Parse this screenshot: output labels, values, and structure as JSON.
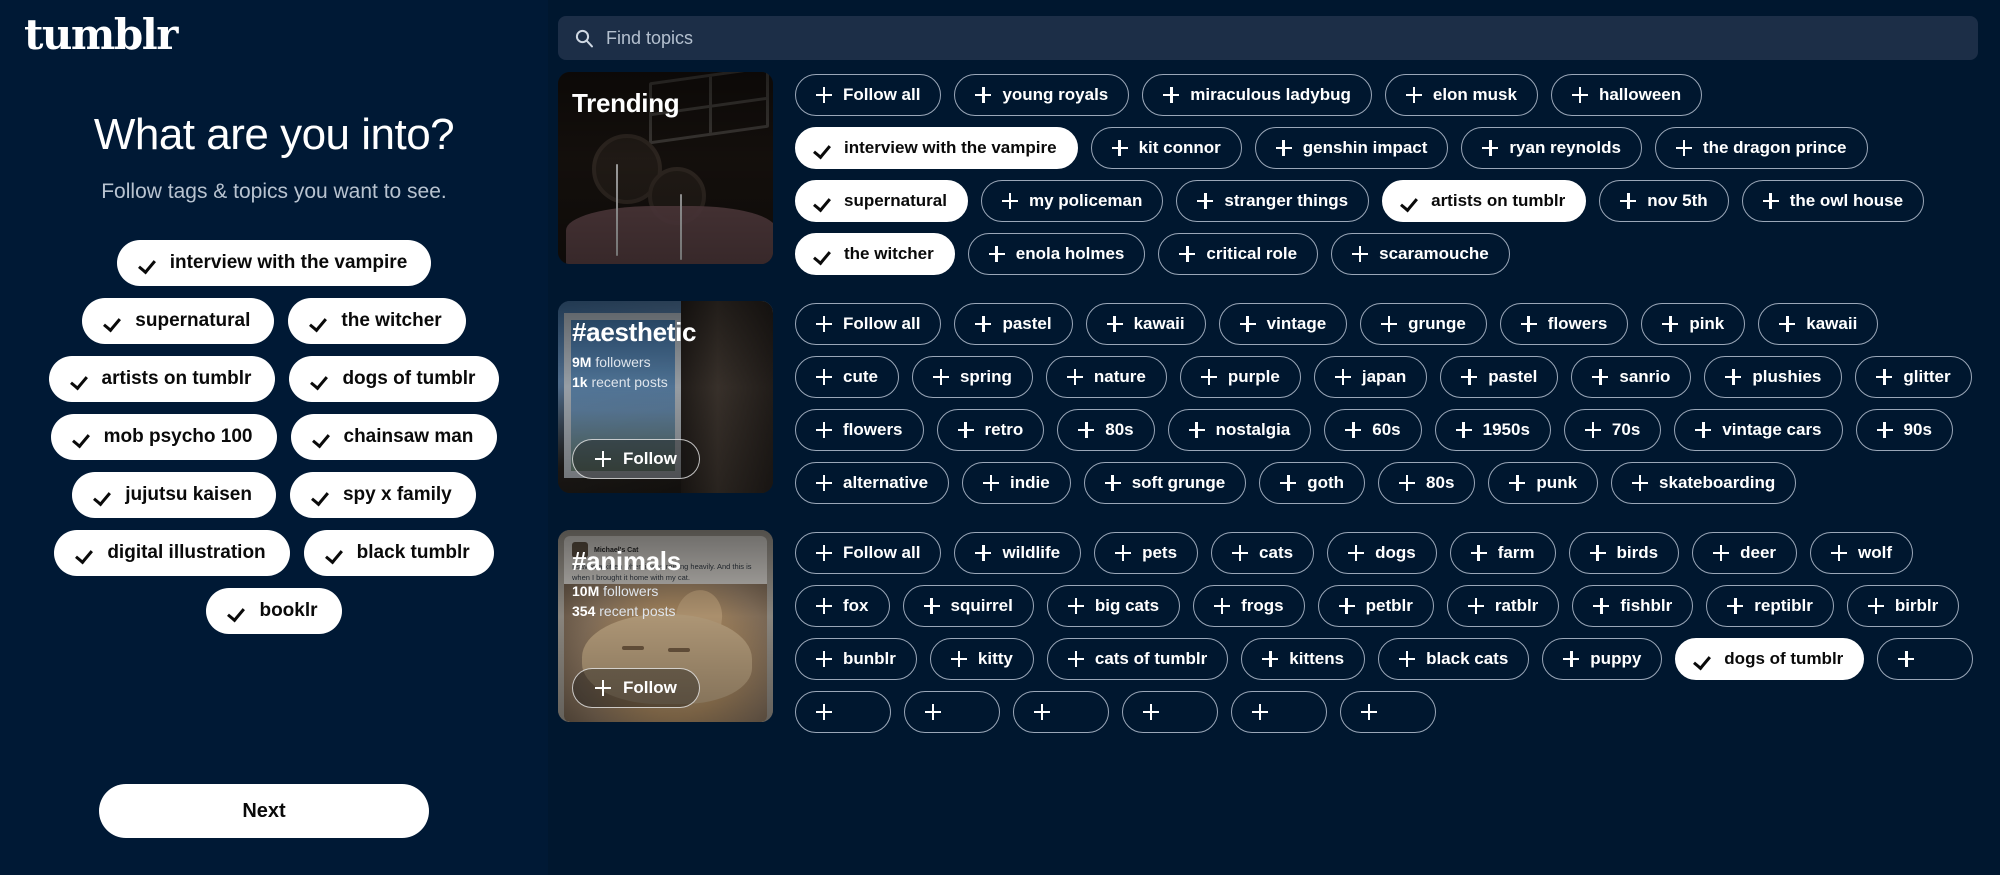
{
  "brand": {
    "logo_text": "tumblr",
    "background_color": "#001935",
    "accent_color": "#ffffff"
  },
  "left_panel": {
    "heading": "What are you into?",
    "subheading": "Follow tags & topics you want to see.",
    "next_label": "Next",
    "selected_tags": [
      "interview with the vampire",
      "supernatural",
      "the witcher",
      "artists on tumblr",
      "dogs of tumblr",
      "mob psycho 100",
      "chainsaw man",
      "jujutsu kaisen",
      "spy x family",
      "digital illustration",
      "black tumblr",
      "booklr"
    ]
  },
  "search": {
    "placeholder": "Find topics",
    "value": "",
    "icon": "search-icon"
  },
  "sections": [
    {
      "card": {
        "title": "Trending",
        "followers": "",
        "recent_posts": "",
        "follow_label": "",
        "has_follow_button": false,
        "art": "trending"
      },
      "tags": [
        {
          "label": "Follow all",
          "selected": false
        },
        {
          "label": "young royals",
          "selected": false
        },
        {
          "label": "miraculous ladybug",
          "selected": false
        },
        {
          "label": "elon musk",
          "selected": false
        },
        {
          "label": "halloween",
          "selected": false
        },
        {
          "label": "interview with the vampire",
          "selected": true
        },
        {
          "label": "kit connor",
          "selected": false
        },
        {
          "label": "genshin impact",
          "selected": false
        },
        {
          "label": "ryan reynolds",
          "selected": false
        },
        {
          "label": "the dragon prince",
          "selected": false
        },
        {
          "label": "supernatural",
          "selected": true
        },
        {
          "label": "my policeman",
          "selected": false
        },
        {
          "label": "stranger things",
          "selected": false
        },
        {
          "label": "artists on tumblr",
          "selected": true
        },
        {
          "label": "nov 5th",
          "selected": false
        },
        {
          "label": "the owl house",
          "selected": false
        },
        {
          "label": "the witcher",
          "selected": true
        },
        {
          "label": "enola holmes",
          "selected": false
        },
        {
          "label": "critical role",
          "selected": false
        },
        {
          "label": "scaramouche",
          "selected": false
        }
      ]
    },
    {
      "card": {
        "title": "#aesthetic",
        "followers_value": "9M",
        "followers_label": "followers",
        "recent_value": "1k",
        "recent_label": "recent posts",
        "follow_label": "Follow",
        "has_follow_button": true,
        "art": "aesthetic"
      },
      "tags": [
        {
          "label": "Follow all",
          "selected": false
        },
        {
          "label": "pastel",
          "selected": false
        },
        {
          "label": "kawaii",
          "selected": false
        },
        {
          "label": "vintage",
          "selected": false
        },
        {
          "label": "grunge",
          "selected": false
        },
        {
          "label": "flowers",
          "selected": false
        },
        {
          "label": "pink",
          "selected": false
        },
        {
          "label": "kawaii",
          "selected": false
        },
        {
          "label": "cute",
          "selected": false
        },
        {
          "label": "spring",
          "selected": false
        },
        {
          "label": "nature",
          "selected": false
        },
        {
          "label": "purple",
          "selected": false
        },
        {
          "label": "japan",
          "selected": false
        },
        {
          "label": "pastel",
          "selected": false
        },
        {
          "label": "sanrio",
          "selected": false
        },
        {
          "label": "plushies",
          "selected": false
        },
        {
          "label": "glitter",
          "selected": false
        },
        {
          "label": "flowers",
          "selected": false
        },
        {
          "label": "retro",
          "selected": false
        },
        {
          "label": "80s",
          "selected": false
        },
        {
          "label": "nostalgia",
          "selected": false
        },
        {
          "label": "60s",
          "selected": false
        },
        {
          "label": "1950s",
          "selected": false
        },
        {
          "label": "70s",
          "selected": false
        },
        {
          "label": "vintage cars",
          "selected": false
        },
        {
          "label": "90s",
          "selected": false
        },
        {
          "label": "alternative",
          "selected": false
        },
        {
          "label": "indie",
          "selected": false
        },
        {
          "label": "soft grunge",
          "selected": false
        },
        {
          "label": "goth",
          "selected": false
        },
        {
          "label": "80s",
          "selected": false
        },
        {
          "label": "punk",
          "selected": false
        },
        {
          "label": "skateboarding",
          "selected": false
        }
      ]
    },
    {
      "card": {
        "title": "#animals",
        "followers_value": "10M",
        "followers_label": "followers",
        "recent_value": "354",
        "recent_label": "recent posts",
        "follow_label": "Follow",
        "has_follow_button": true,
        "art": "animals",
        "post_author": "Michael's Cat",
        "post_text": "I saved a kitten when it was raining heavily. And this is when I brought it home with my cat."
      },
      "tags": [
        {
          "label": "Follow all",
          "selected": false
        },
        {
          "label": "wildlife",
          "selected": false
        },
        {
          "label": "pets",
          "selected": false
        },
        {
          "label": "cats",
          "selected": false
        },
        {
          "label": "dogs",
          "selected": false
        },
        {
          "label": "farm",
          "selected": false
        },
        {
          "label": "birds",
          "selected": false
        },
        {
          "label": "deer",
          "selected": false
        },
        {
          "label": "wolf",
          "selected": false
        },
        {
          "label": "fox",
          "selected": false
        },
        {
          "label": "squirrel",
          "selected": false
        },
        {
          "label": "big cats",
          "selected": false
        },
        {
          "label": "frogs",
          "selected": false
        },
        {
          "label": "petblr",
          "selected": false
        },
        {
          "label": "ratblr",
          "selected": false
        },
        {
          "label": "fishblr",
          "selected": false
        },
        {
          "label": "reptiblr",
          "selected": false
        },
        {
          "label": "birblr",
          "selected": false
        },
        {
          "label": "bunblr",
          "selected": false
        },
        {
          "label": "kitty",
          "selected": false
        },
        {
          "label": "cats of tumblr",
          "selected": false
        },
        {
          "label": "kittens",
          "selected": false
        },
        {
          "label": "black cats",
          "selected": false
        },
        {
          "label": "puppy",
          "selected": false
        },
        {
          "label": "dogs of tumblr",
          "selected": true
        },
        {
          "label": "",
          "selected": false
        },
        {
          "label": "",
          "selected": false
        },
        {
          "label": "",
          "selected": false
        },
        {
          "label": "",
          "selected": false
        },
        {
          "label": "",
          "selected": false
        },
        {
          "label": "",
          "selected": false
        },
        {
          "label": "",
          "selected": false
        }
      ]
    }
  ]
}
